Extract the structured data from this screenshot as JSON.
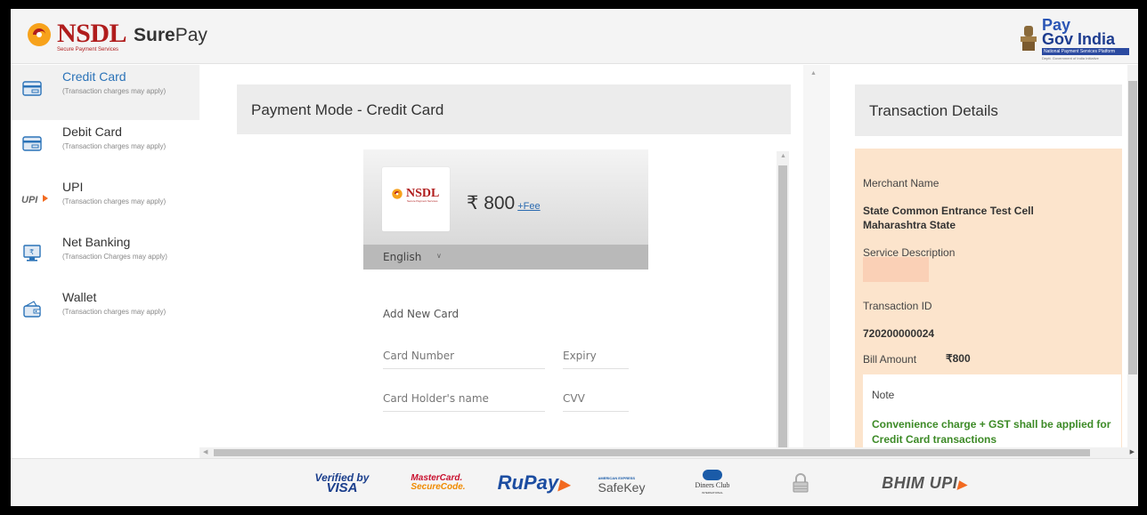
{
  "header": {
    "nsdl_brand": "NSDL",
    "nsdl_tagline": "Secure Payment Services",
    "product_name_bold": "Sure",
    "product_name_rest": "Pay",
    "paygov_line1": "Pay",
    "paygov_line2": "Gov India",
    "paygov_bar": "National Payment Services Platform",
    "paygov_sub": "Deptt. Government of India Initiative"
  },
  "sidebar": {
    "items": [
      {
        "label": "Credit Card",
        "note": "(Transaction charges may apply)",
        "icon": "credit-card-icon",
        "active": true
      },
      {
        "label": "Debit Card",
        "note": "(Transaction charges may apply)",
        "icon": "debit-card-icon",
        "active": false
      },
      {
        "label": "UPI",
        "note": "(Transaction charges may apply)",
        "icon": "upi-icon",
        "active": false
      },
      {
        "label": "Net Banking",
        "note": "(Transaction Charges may apply)",
        "icon": "net-banking-icon",
        "active": false
      },
      {
        "label": "Wallet",
        "note": "(Transaction charges may apply)",
        "icon": "wallet-icon",
        "active": false
      }
    ]
  },
  "main": {
    "title": "Payment Mode - Credit Card"
  },
  "checkout": {
    "logo_brand": "NSDL",
    "logo_tagline": "Secure Payment Services",
    "amount": "₹ 800",
    "fee_link": "+Fee",
    "language": "English",
    "add_new_card": "Add New Card",
    "card_number_placeholder": "Card Number",
    "expiry_placeholder": "Expiry",
    "holder_placeholder": "Card Holder's name",
    "cvv_placeholder": "CVV"
  },
  "transaction": {
    "title": "Transaction Details",
    "merchant_label": "Merchant Name",
    "merchant_value": "State Common Entrance Test Cell Maharashtra State",
    "service_label": "Service Description",
    "txn_id_label": "Transaction ID",
    "txn_id_value": "720200000024",
    "bill_label": "Bill Amount",
    "bill_value": "₹800",
    "note_label": "Note",
    "note_text": "Convenience charge + GST shall be applied for Credit Card transactions"
  },
  "footer": {
    "verified_by": "Verified by",
    "visa": "VISA",
    "mastercard": "MasterCard.",
    "securecode": "SecureCode.",
    "rupay": "RuPay",
    "amex_small": "AMERICAN EXPRESS",
    "safekey": "SafeKey",
    "diners": "Diners Club",
    "diners_sub": "INTERNATIONAL",
    "bhim_upi": "BHIM UPI"
  },
  "colors": {
    "accent_blue": "#2b73b8",
    "nsdl_red": "#b01d1d",
    "transaction_bg": "#fce4cc",
    "note_green": "#3c8a26"
  }
}
